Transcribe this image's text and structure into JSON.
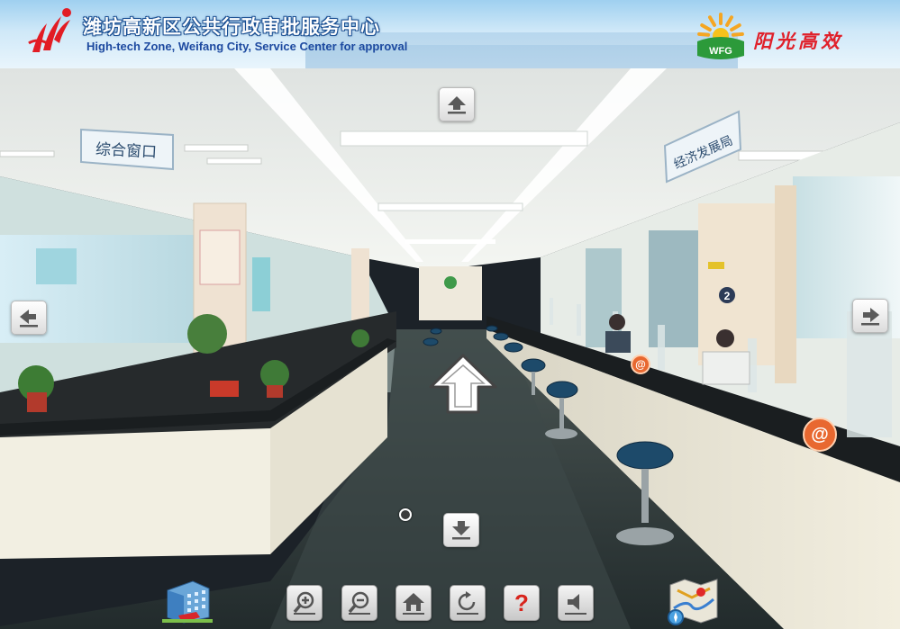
{
  "header": {
    "title_cn": "潍坊高新区公共行政审批服务中心",
    "title_en": "High-tech Zone, Weifang City, Service Center for approval",
    "slogan": "阳光高效",
    "wfg_logo_text": "WFG"
  },
  "scene": {
    "sign_left": "综合窗口",
    "sign_right": "经济发展局",
    "counter_number": "2"
  },
  "navigation": {
    "up_icon": "arrow-up-icon",
    "down_icon": "arrow-down-icon",
    "left_icon": "arrow-left-icon",
    "right_icon": "arrow-right-icon",
    "forward_icon": "forward-arrow-icon"
  },
  "toolbar": {
    "items": [
      {
        "name": "zoom-in",
        "icon": "zoom-in-icon"
      },
      {
        "name": "zoom-out",
        "icon": "zoom-out-icon"
      },
      {
        "name": "home",
        "icon": "home-icon"
      },
      {
        "name": "rotate",
        "icon": "auto-rotate-icon"
      },
      {
        "name": "help",
        "icon": "help-icon",
        "label": "?"
      },
      {
        "name": "sound",
        "icon": "speaker-icon"
      }
    ]
  },
  "colors": {
    "header_title": "#ffffff",
    "header_outline": "#1a4f92",
    "header_en": "#1d4aa0",
    "slogan": "#e0202a",
    "help_mark": "#d8241c",
    "floor": "#2f3a3c"
  }
}
